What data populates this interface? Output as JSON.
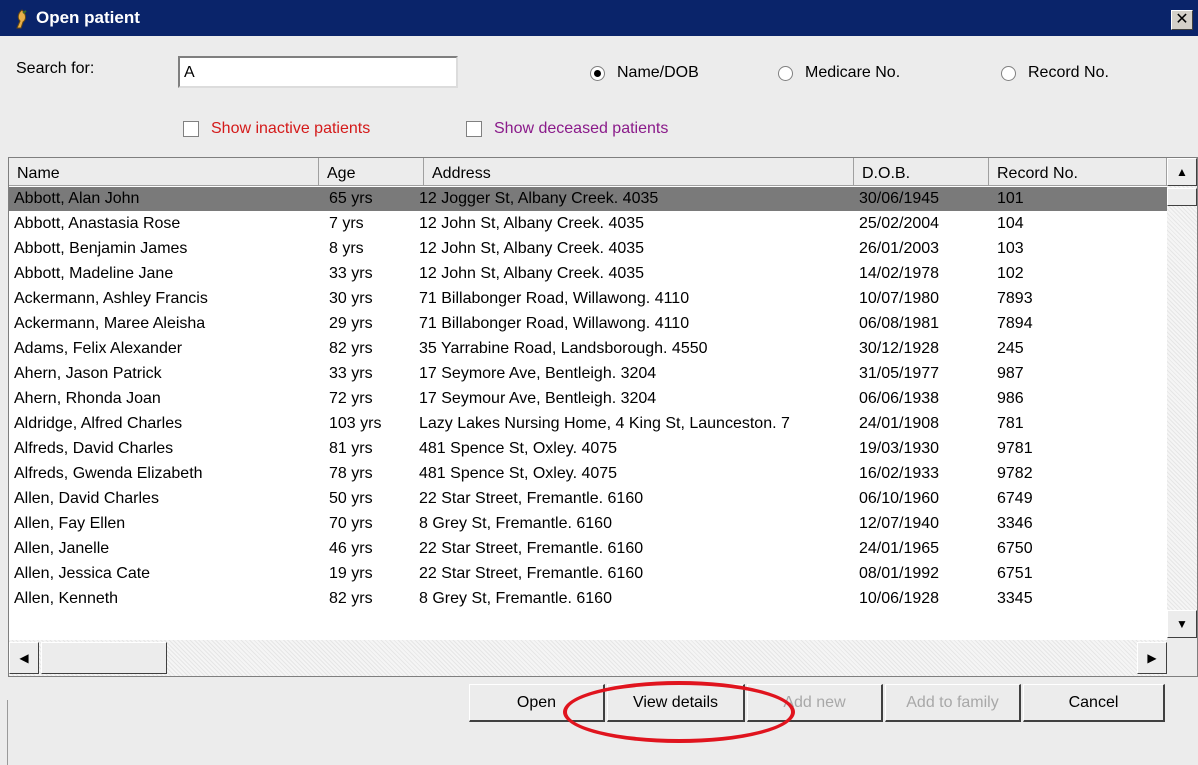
{
  "window": {
    "title": "Open patient",
    "close": "✕"
  },
  "search": {
    "label": "Search for:",
    "value": "A"
  },
  "search_mode": [
    {
      "label": "Name/DOB",
      "selected": true
    },
    {
      "label": "Medicare No.",
      "selected": false
    },
    {
      "label": "Record No.",
      "selected": false
    }
  ],
  "filters": {
    "inactive": {
      "label": "Show inactive patients",
      "checked": false,
      "color": "#d41a1a"
    },
    "deceased": {
      "label": "Show deceased patients",
      "checked": false,
      "color": "#8a1a8a"
    }
  },
  "table": {
    "columns": [
      "Name",
      "Age",
      "Address",
      "D.O.B.",
      "Record No."
    ],
    "rows": [
      [
        "Abbott, Alan John",
        "65 yrs",
        "12 Jogger St, Albany Creek. 4035",
        "30/06/1945",
        "101"
      ],
      [
        "Abbott, Anastasia Rose",
        "7 yrs",
        "12 John St, Albany Creek. 4035",
        "25/02/2004",
        "104"
      ],
      [
        "Abbott, Benjamin James",
        "8 yrs",
        "12 John St, Albany Creek. 4035",
        "26/01/2003",
        "103"
      ],
      [
        "Abbott, Madeline Jane",
        "33 yrs",
        "12 John St, Albany Creek. 4035",
        "14/02/1978",
        "102"
      ],
      [
        "Ackermann, Ashley Francis",
        "30 yrs",
        "71 Billabonger Road, Willawong. 4110",
        "10/07/1980",
        "7893"
      ],
      [
        "Ackermann, Maree Aleisha",
        "29 yrs",
        "71 Billabonger Road, Willawong. 4110",
        "06/08/1981",
        "7894"
      ],
      [
        "Adams, Felix Alexander",
        "82 yrs",
        "35 Yarrabine Road, Landsborough. 4550",
        "30/12/1928",
        "245"
      ],
      [
        "Ahern, Jason Patrick",
        "33 yrs",
        "17 Seymore Ave, Bentleigh. 3204",
        "31/05/1977",
        "987"
      ],
      [
        "Ahern, Rhonda Joan",
        "72 yrs",
        "17 Seymour Ave, Bentleigh. 3204",
        "06/06/1938",
        "986"
      ],
      [
        "Aldridge, Alfred Charles",
        "103 yrs",
        "Lazy Lakes Nursing Home, 4 King St, Launceston. 7",
        "24/01/1908",
        "781"
      ],
      [
        "Alfreds, David Charles",
        "81 yrs",
        "481 Spence St, Oxley. 4075",
        "19/03/1930",
        "9781"
      ],
      [
        "Alfreds, Gwenda Elizabeth",
        "78 yrs",
        "481 Spence St, Oxley. 4075",
        "16/02/1933",
        "9782"
      ],
      [
        "Allen, David Charles",
        "50 yrs",
        "22 Star Street, Fremantle. 6160",
        "06/10/1960",
        "6749"
      ],
      [
        "Allen, Fay Ellen",
        "70 yrs",
        "8 Grey St, Fremantle. 6160",
        "12/07/1940",
        "3346"
      ],
      [
        "Allen, Janelle",
        "46 yrs",
        "22 Star Street, Fremantle. 6160",
        "24/01/1965",
        "6750"
      ],
      [
        "Allen, Jessica Cate",
        "19 yrs",
        "22 Star Street, Fremantle. 6160",
        "08/01/1992",
        "6751"
      ],
      [
        "Allen, Kenneth",
        "82 yrs",
        "8 Grey St, Fremantle. 6160",
        "10/06/1928",
        "3345"
      ]
    ],
    "selected_row": 0
  },
  "buttons": {
    "open": "Open",
    "view_details": "View details",
    "add_new": "Add new",
    "add_to_family": "Add to family",
    "cancel": "Cancel"
  },
  "icons": {
    "scroll_up": "▲",
    "scroll_down": "▼",
    "scroll_left": "◀",
    "scroll_right": "▶"
  },
  "highlight_color": "#e0141e"
}
